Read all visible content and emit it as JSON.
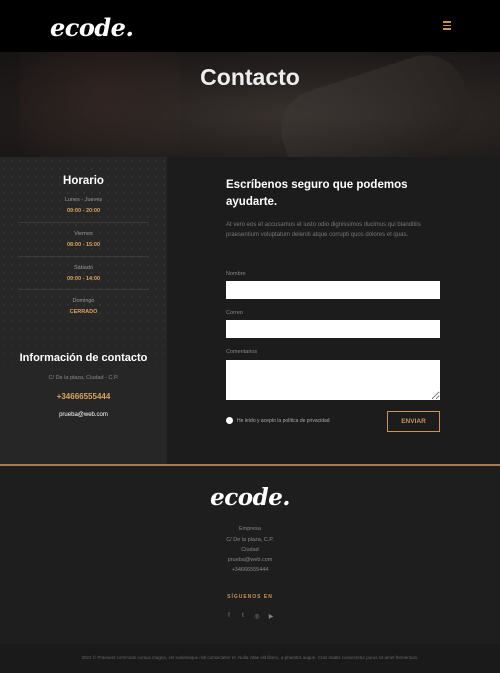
{
  "header": {
    "logo": "ecode",
    "menu_icon": "hamburger-menu-icon"
  },
  "hero": {
    "title": "Contacto"
  },
  "schedule": {
    "title": "Horario",
    "days": [
      {
        "day": "Lunes - Jueves",
        "hours": "09:00 - 20:00"
      },
      {
        "day": "Viernes",
        "hours": "08:00 - 15:00"
      },
      {
        "day": "Sábado",
        "hours": "09:00 - 14:00"
      },
      {
        "day": "Domingo",
        "hours": "CERRADO"
      }
    ]
  },
  "contact_info": {
    "title": "Información de contacto",
    "address": "C/ De la plaza, Ciudad - C.P.",
    "phone": "+34666555444",
    "email": "prueba@web.com"
  },
  "form": {
    "title": "Escríbenos seguro que podemos ayudarte.",
    "description": "At vero eos et accusamus et iusto odio dignissimos ducimus qui blanditiis praesentium voluptatum deleniti atque corrupti quos dolores et quas.",
    "name_label": "Nombre",
    "email_label": "Correo",
    "comments_label": "Comentarios",
    "privacy_label": "He leído y acepto la política de privacidad",
    "send_label": "ENVIAR"
  },
  "footer": {
    "logo": "ecode",
    "lines": [
      "Empresa",
      "C/ De la plaza, C.P.",
      "Ciudad",
      "prueba@web.com",
      "+34666555444"
    ],
    "follow_label": "SÍGUENOS EN",
    "social": [
      {
        "name": "facebook-icon",
        "glyph": "f"
      },
      {
        "name": "twitter-icon",
        "glyph": "t"
      },
      {
        "name": "instagram-icon",
        "glyph": "◎"
      },
      {
        "name": "youtube-icon",
        "glyph": "▶"
      }
    ],
    "copyright": "2021 © Praesent commodo cursus magna, vel scelerisque nisl consectetur et. Nulla vitae elit libero, a pharetra augue. Cras mattis consectetur purus sit amet fermentum."
  },
  "colors": {
    "accent": "#c8955a",
    "header_bg": "#000000",
    "page_bg": "#1c1c1c"
  }
}
